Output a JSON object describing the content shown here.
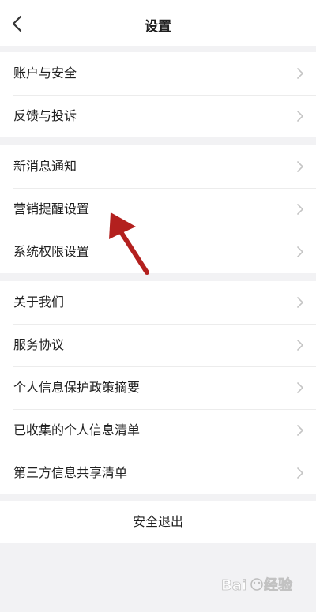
{
  "header": {
    "title": "设置",
    "back_icon": "chevron-left-icon"
  },
  "groups": [
    {
      "items": [
        {
          "label": "账户与安全"
        },
        {
          "label": "反馈与投诉"
        }
      ]
    },
    {
      "items": [
        {
          "label": "新消息通知"
        },
        {
          "label": "营销提醒设置"
        },
        {
          "label": "系统权限设置"
        }
      ]
    },
    {
      "items": [
        {
          "label": "关于我们"
        },
        {
          "label": "服务协议"
        },
        {
          "label": "个人信息保护政策摘要"
        },
        {
          "label": "已收集的个人信息清单"
        },
        {
          "label": "第三方信息共享清单"
        }
      ]
    }
  ],
  "logout": {
    "label": "安全退出"
  },
  "annotation": {
    "icon": "red-arrow-annotation",
    "color": "#b3201e"
  },
  "watermark": {
    "text": "Baidu经验"
  },
  "colors": {
    "background": "#f2f2f4",
    "surface": "#ffffff",
    "chevron": "#c4c4c4",
    "text": "#1f1f1f"
  }
}
